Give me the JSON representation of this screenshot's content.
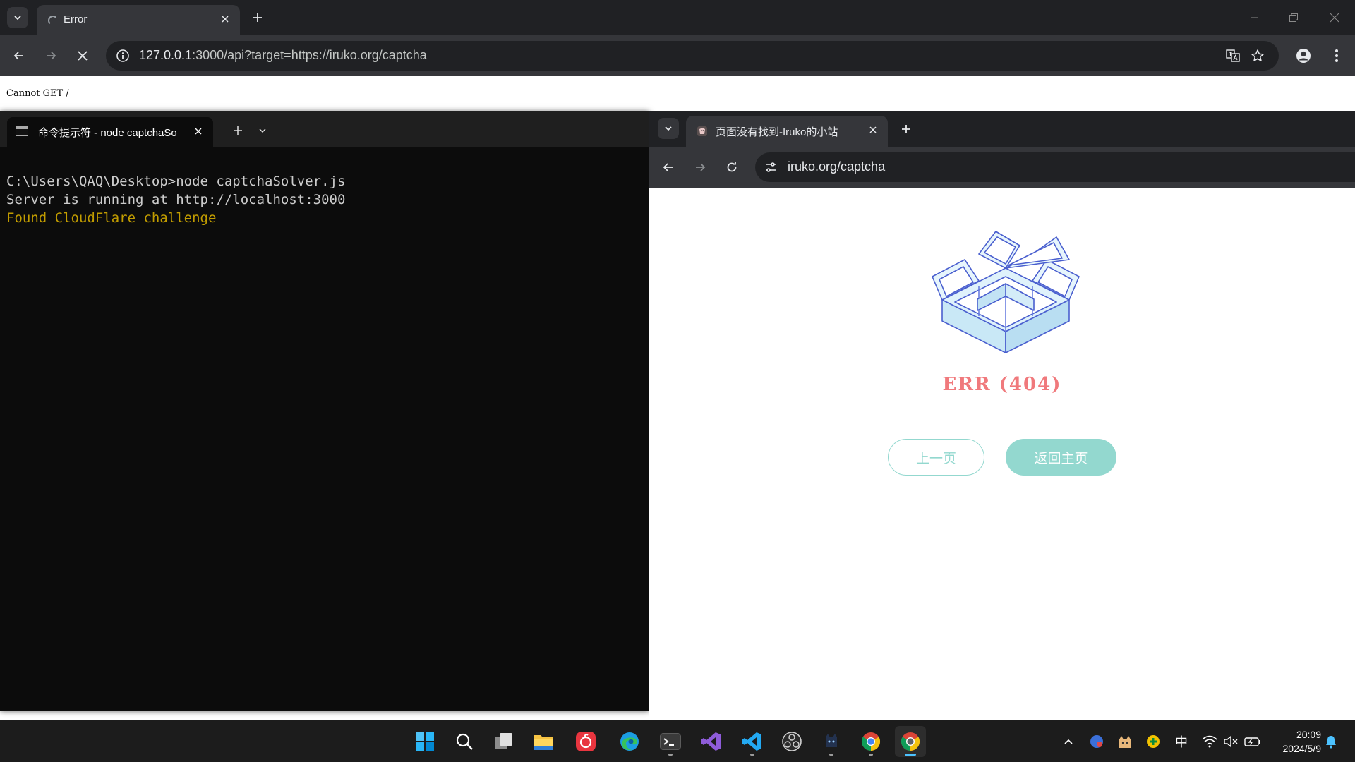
{
  "browser_main": {
    "tab_title": "Error",
    "url_host": "127.0.0.1",
    "url_rest": ":3000/api?target=https://iruko.org/captcha",
    "content_text": "Cannot GET /"
  },
  "terminal": {
    "tab_title": "命令提示符 - node  captchaSo",
    "lines": [
      "C:\\Users\\QAQ\\Desktop>node captchaSolver.js",
      "Server is running at http://localhost:3000"
    ],
    "highlight_line": "Found CloudFlare challenge"
  },
  "browser_second": {
    "tab_title": "页面没有找到-Iruko的小站",
    "url": "iruko.org/captcha",
    "error_text": "ERR (404)",
    "buttons": {
      "prev": "上一页",
      "home": "返回主页"
    }
  },
  "taskbar": {
    "time": "20:09",
    "date": "2024/5/9",
    "ime": "中",
    "apps": [
      "start-icon",
      "search-icon",
      "task-view-icon",
      "file-explorer-icon",
      "netease-music-icon",
      "edge-icon",
      "terminal-icon",
      "visual-studio-icon",
      "vscode-icon",
      "obs-icon",
      "cat-app-icon",
      "chrome-icon",
      "chrome-test-icon"
    ]
  },
  "colors": {
    "accent_teal": "#93d8cf",
    "error_red": "#f0797c",
    "terminal_yellow": "#c19c00",
    "chrome_dark": "#202124",
    "chrome_toolbar": "#35363a"
  }
}
